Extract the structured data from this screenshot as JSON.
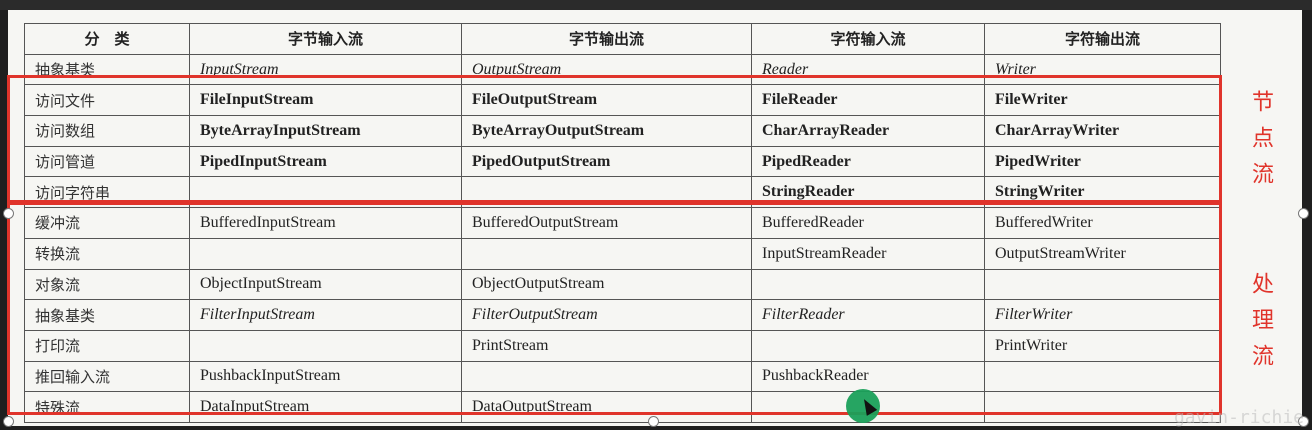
{
  "table": {
    "headers": [
      "分　类",
      "字节输入流",
      "字节输出流",
      "字符输入流",
      "字符输出流"
    ],
    "rows": [
      {
        "cat": "抽象基类",
        "c1": "InputStream",
        "c2": "OutputStream",
        "c3": "Reader",
        "c4": "Writer"
      },
      {
        "cat": "访问文件",
        "c1": "FileInputStream",
        "c2": "FileOutputStream",
        "c3": "FileReader",
        "c4": "FileWriter"
      },
      {
        "cat": "访问数组",
        "c1": "ByteArrayInputStream",
        "c2": "ByteArrayOutputStream",
        "c3": "CharArrayReader",
        "c4": "CharArrayWriter"
      },
      {
        "cat": "访问管道",
        "c1": "PipedInputStream",
        "c2": "PipedOutputStream",
        "c3": "PipedReader",
        "c4": "PipedWriter"
      },
      {
        "cat": "访问字符串",
        "c1": "",
        "c2": "",
        "c3": "StringReader",
        "c4": "StringWriter"
      },
      {
        "cat": "缓冲流",
        "c1": "BufferedInputStream",
        "c2": "BufferedOutputStream",
        "c3": "BufferedReader",
        "c4": "BufferedWriter"
      },
      {
        "cat": "转换流",
        "c1": "",
        "c2": "",
        "c3": "InputStreamReader",
        "c4": "OutputStreamWriter"
      },
      {
        "cat": "对象流",
        "c1": "ObjectInputStream",
        "c2": "ObjectOutputStream",
        "c3": "",
        "c4": ""
      },
      {
        "cat": "抽象基类",
        "c1": "FilterInputStream",
        "c2": "FilterOutputStream",
        "c3": "FilterReader",
        "c4": "FilterWriter"
      },
      {
        "cat": "打印流",
        "c1": "",
        "c2": "PrintStream",
        "c3": "",
        "c4": "PrintWriter"
      },
      {
        "cat": "推回输入流",
        "c1": "PushbackInputStream",
        "c2": "",
        "c3": "PushbackReader",
        "c4": ""
      },
      {
        "cat": "特殊流",
        "c1": "DataInputStream",
        "c2": "DataOutputStream",
        "c3": "",
        "c4": ""
      }
    ]
  },
  "annotations": {
    "node_stream": "节点流",
    "processing_stream": "处理流",
    "color": "#e0342b"
  },
  "watermark": "gavin-richie"
}
